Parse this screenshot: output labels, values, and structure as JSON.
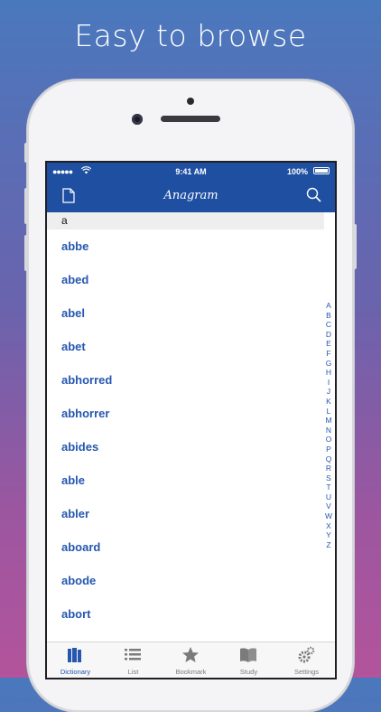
{
  "headline": "Easy to browse",
  "status_bar": {
    "signal": "●●●●●",
    "time": "9:41 AM",
    "battery": "100%"
  },
  "nav": {
    "title": "Anagram",
    "left_icon": "document-icon",
    "right_icon": "search-icon"
  },
  "search": {
    "value": "a"
  },
  "words": [
    "abbe",
    "abed",
    "abel",
    "abet",
    "abhorred",
    "abhorrer",
    "abides",
    "able",
    "abler",
    "aboard",
    "abode",
    "abort"
  ],
  "index_letters": [
    "A",
    "B",
    "C",
    "D",
    "E",
    "F",
    "G",
    "H",
    "I",
    "J",
    "K",
    "L",
    "M",
    "N",
    "O",
    "P",
    "Q",
    "R",
    "S",
    "T",
    "U",
    "V",
    "W",
    "X",
    "Y",
    "Z"
  ],
  "tabs": [
    {
      "label": "Dictionary",
      "icon": "books-icon",
      "active": true
    },
    {
      "label": "List",
      "icon": "list-icon",
      "active": false
    },
    {
      "label": "Bookmark",
      "icon": "star-icon",
      "active": false
    },
    {
      "label": "Study",
      "icon": "open-book-icon",
      "active": false
    },
    {
      "label": "Settings",
      "icon": "gears-icon",
      "active": false
    }
  ],
  "colors": {
    "accent": "#1e4fa1",
    "link": "#2557b0",
    "tab_inactive": "#7b7b7b"
  }
}
